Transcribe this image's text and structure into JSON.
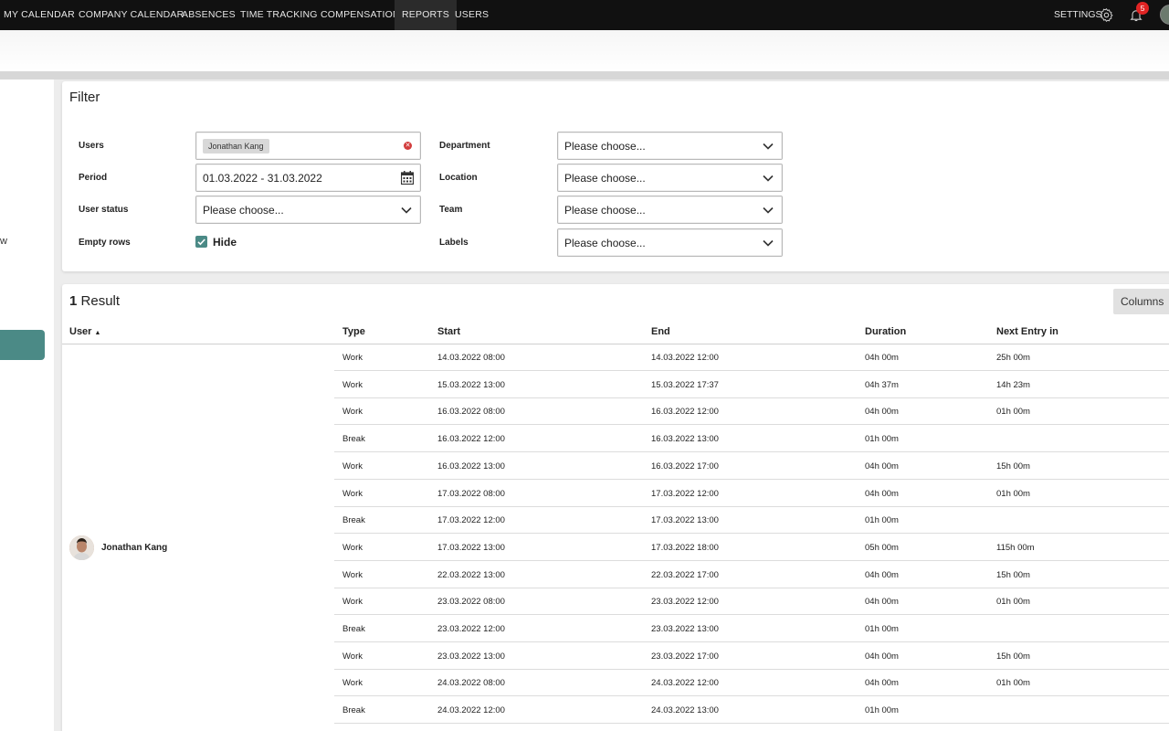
{
  "nav": {
    "items": [
      {
        "label": "MY CALENDAR"
      },
      {
        "label": "COMPANY CALENDAR"
      },
      {
        "label": "ABSENCES"
      },
      {
        "label": "TIME TRACKING"
      },
      {
        "label": "COMPENSATION"
      },
      {
        "label": "REPORTS"
      },
      {
        "label": "USERS"
      }
    ],
    "active": "REPORTS",
    "settings_label": "SETTINGS",
    "notification_count": "5"
  },
  "sidebar": {
    "partial_text": "w"
  },
  "filter": {
    "title": "Filter",
    "users_label": "Users",
    "users_chip": "Jonathan Kang",
    "period_label": "Period",
    "period_value": "01.03.2022 - 31.03.2022",
    "user_status_label": "User status",
    "user_status_value": "Please choose...",
    "empty_rows_label": "Empty rows",
    "empty_rows_value": "Hide",
    "department_label": "Department",
    "department_value": "Please choose...",
    "location_label": "Location",
    "location_value": "Please choose...",
    "team_label": "Team",
    "team_value": "Please choose...",
    "labels_label": "Labels",
    "labels_value": "Please choose..."
  },
  "results": {
    "count": "1",
    "count_label": "Result",
    "columns_button": "Columns",
    "headers": {
      "user": "User",
      "type": "Type",
      "start": "Start",
      "end": "End",
      "duration": "Duration",
      "next_entry": "Next Entry in"
    },
    "user_name": "Jonathan Kang",
    "rows": [
      {
        "type": "Work",
        "start": "14.03.2022 08:00",
        "end": "14.03.2022 12:00",
        "duration": "04h 00m",
        "next": "25h 00m"
      },
      {
        "type": "Work",
        "start": "15.03.2022 13:00",
        "end": "15.03.2022 17:37",
        "duration": "04h 37m",
        "next": "14h 23m"
      },
      {
        "type": "Work",
        "start": "16.03.2022 08:00",
        "end": "16.03.2022 12:00",
        "duration": "04h 00m",
        "next": "01h 00m"
      },
      {
        "type": "Break",
        "start": "16.03.2022 12:00",
        "end": "16.03.2022 13:00",
        "duration": "01h 00m",
        "next": ""
      },
      {
        "type": "Work",
        "start": "16.03.2022 13:00",
        "end": "16.03.2022 17:00",
        "duration": "04h 00m",
        "next": "15h 00m"
      },
      {
        "type": "Work",
        "start": "17.03.2022 08:00",
        "end": "17.03.2022 12:00",
        "duration": "04h 00m",
        "next": "01h 00m"
      },
      {
        "type": "Break",
        "start": "17.03.2022 12:00",
        "end": "17.03.2022 13:00",
        "duration": "01h 00m",
        "next": ""
      },
      {
        "type": "Work",
        "start": "17.03.2022 13:00",
        "end": "17.03.2022 18:00",
        "duration": "05h 00m",
        "next": "115h 00m"
      },
      {
        "type": "Work",
        "start": "22.03.2022 13:00",
        "end": "22.03.2022 17:00",
        "duration": "04h 00m",
        "next": "15h 00m"
      },
      {
        "type": "Work",
        "start": "23.03.2022 08:00",
        "end": "23.03.2022 12:00",
        "duration": "04h 00m",
        "next": "01h 00m"
      },
      {
        "type": "Break",
        "start": "23.03.2022 12:00",
        "end": "23.03.2022 13:00",
        "duration": "01h 00m",
        "next": ""
      },
      {
        "type": "Work",
        "start": "23.03.2022 13:00",
        "end": "23.03.2022 17:00",
        "duration": "04h 00m",
        "next": "15h 00m"
      },
      {
        "type": "Work",
        "start": "24.03.2022 08:00",
        "end": "24.03.2022 12:00",
        "duration": "04h 00m",
        "next": "01h 00m"
      },
      {
        "type": "Break",
        "start": "24.03.2022 12:00",
        "end": "24.03.2022 13:00",
        "duration": "01h 00m",
        "next": ""
      }
    ]
  },
  "colors": {
    "nav_bg": "#111111",
    "accent": "#4b8a86",
    "badge": "#e02424"
  }
}
